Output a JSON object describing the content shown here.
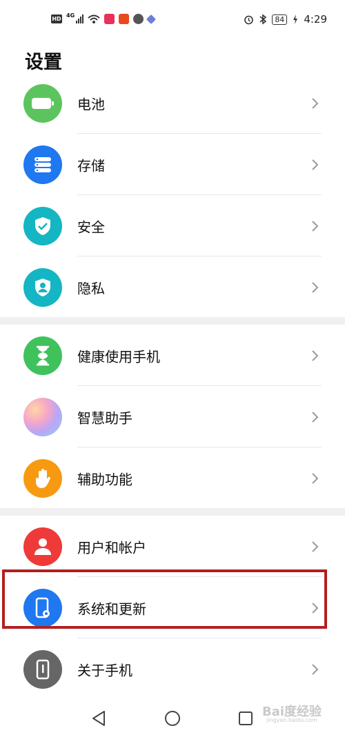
{
  "status_bar": {
    "left_badge": "HD",
    "network": "4G",
    "battery": "84",
    "time": "4:29",
    "icons": [
      "hd-icon",
      "signal-icon",
      "wifi-icon",
      "app-notification-icon",
      "alarm-icon",
      "bluetooth-icon",
      "battery-icon",
      "charging-icon"
    ]
  },
  "page": {
    "title": "设置"
  },
  "items": [
    {
      "label": "电池",
      "icon": "battery-icon",
      "color": "#5cc45f"
    },
    {
      "label": "存储",
      "icon": "storage-icon",
      "color": "#1f78f0"
    },
    {
      "label": "安全",
      "icon": "shield-check-icon",
      "color": "#14b6c3"
    },
    {
      "label": "隐私",
      "icon": "privacy-icon",
      "color": "#14b6c3"
    },
    {
      "label": "健康使用手机",
      "icon": "hourglass-icon",
      "color": "#3fc25c"
    },
    {
      "label": "智慧助手",
      "icon": "assistant-icon",
      "color": "#c7a6f5"
    },
    {
      "label": "辅助功能",
      "icon": "hand-icon",
      "color": "#f79a12"
    },
    {
      "label": "用户和帐户",
      "icon": "user-icon",
      "color": "#ef3a3a"
    },
    {
      "label": "系统和更新",
      "icon": "system-update-icon",
      "color": "#1f78f0"
    },
    {
      "label": "关于手机",
      "icon": "phone-info-icon",
      "color": "#666666"
    }
  ],
  "watermark": {
    "text": "Bai度经验",
    "sub": "jingyan.baidu.com"
  }
}
